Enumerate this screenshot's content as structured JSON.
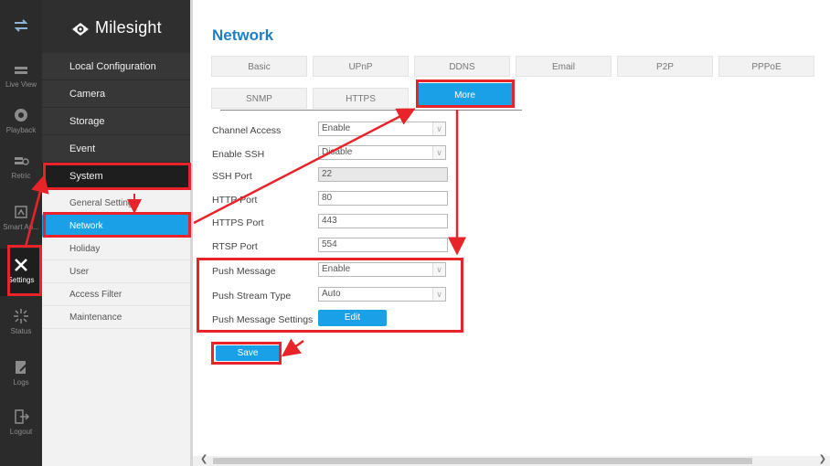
{
  "rail": {
    "items": [
      {
        "label": ""
      },
      {
        "label": "Live View"
      },
      {
        "label": "Playback"
      },
      {
        "label": "Retric"
      },
      {
        "label": "Smart An..."
      },
      {
        "label": "Settings"
      },
      {
        "label": "Status"
      },
      {
        "label": "Logs"
      },
      {
        "label": "Logout"
      }
    ]
  },
  "menu": {
    "logo_text": "Milesight",
    "top_items": [
      "Local Configuration",
      "Camera",
      "Storage",
      "Event",
      "System"
    ],
    "sub_items": [
      "General Settings",
      "Network",
      "Holiday",
      "User",
      "Access Filter",
      "Maintenance"
    ]
  },
  "main": {
    "title": "Network",
    "tabs_row1": [
      "Basic",
      "UPnP",
      "DDNS",
      "Email",
      "P2P",
      "PPPoE"
    ],
    "tabs_row2": [
      "SNMP",
      "HTTPS",
      "More"
    ],
    "form": {
      "channel_access": {
        "label": "Channel Access",
        "value": "Enable"
      },
      "enable_ssh": {
        "label": "Enable SSH",
        "value": "Disable"
      },
      "ssh_port": {
        "label": "SSH Port",
        "value": "22"
      },
      "http_port": {
        "label": "HTTP Port",
        "value": "80"
      },
      "https_port": {
        "label": "HTTPS Port",
        "value": "443"
      },
      "rtsp_port": {
        "label": "RTSP Port",
        "value": "554"
      },
      "push_message": {
        "label": "Push Message",
        "value": "Enable"
      },
      "push_stream_type": {
        "label": "Push Stream Type",
        "value": "Auto"
      },
      "push_message_settings": {
        "label": "Push Message Settings",
        "button": "Edit"
      }
    },
    "save_label": "Save"
  },
  "colors": {
    "accent": "#1aa0e6",
    "title": "#1f7fc4",
    "annotation_red": "#e8242a",
    "rail_bg": "#2b2b2b",
    "menu_bg": "#f2f2f2"
  }
}
